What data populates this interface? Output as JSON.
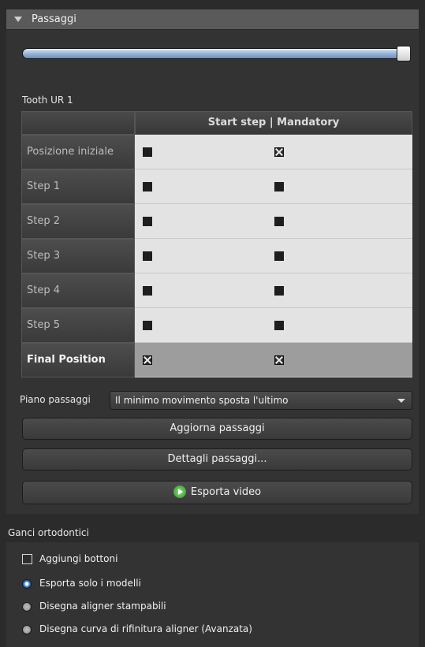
{
  "passaggi": {
    "title": "Passaggi",
    "slider": {
      "position_fraction": 1.0
    },
    "tooth_label": "Tooth UR 1",
    "table": {
      "column_header": "Start step | Mandatory",
      "rows": [
        {
          "label": "Posizione iniziale",
          "start_step": "filled",
          "mandatory": "x"
        },
        {
          "label": "Step 1",
          "start_step": "filled",
          "mandatory": "filled"
        },
        {
          "label": "Step 2",
          "start_step": "filled",
          "mandatory": "filled"
        },
        {
          "label": "Step 3",
          "start_step": "filled",
          "mandatory": "filled"
        },
        {
          "label": "Step 4",
          "start_step": "filled",
          "mandatory": "filled"
        },
        {
          "label": "Step 5",
          "start_step": "filled",
          "mandatory": "filled"
        },
        {
          "label": "Final Position",
          "start_step": "x",
          "mandatory": "x"
        }
      ]
    },
    "plan_label": "Piano passaggi",
    "plan_value": "Il minimo movimento sposta l'ultimo",
    "buttons": {
      "update": "Aggiorna passaggi",
      "details": "Dettagli passaggi...",
      "export_video": "Esporta video"
    }
  },
  "hooks": {
    "title": "Ganci ortodontici",
    "add_buttons": {
      "label": "Aggiungi bottoni",
      "checked": false
    },
    "options": [
      {
        "label": "Esporta solo i modelli",
        "selected": true
      },
      {
        "label": "Disegna aligner stampabili",
        "selected": false
      },
      {
        "label": "Disegna curva di rifinitura aligner (Avanzata)",
        "selected": false
      }
    ]
  },
  "colors": {
    "panel_bg": "#333333",
    "header_bg": "#5a5a5a",
    "table_cells": "#e3e3e3",
    "final_row": "#9d9d9d",
    "slider_blue": "#6c8fb9",
    "radio_active": "#3c84d6"
  }
}
